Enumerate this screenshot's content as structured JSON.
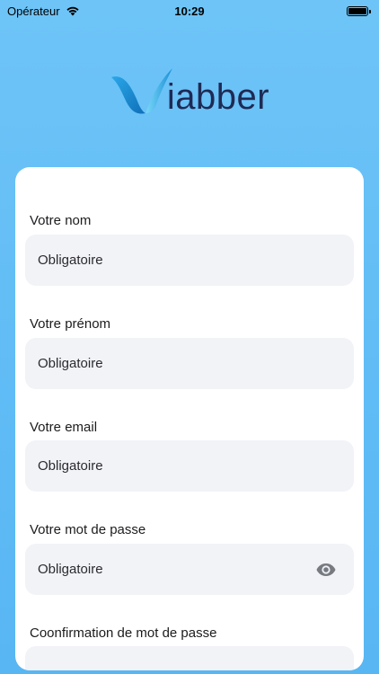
{
  "status_bar": {
    "carrier": "Opérateur",
    "time": "10:29",
    "battery_level": 1.0
  },
  "logo": {
    "mark_letter": "V",
    "text": "iabber",
    "colors": {
      "mark_primary": "#1a8fd6",
      "mark_secondary": "#6ad3f5",
      "text": "#1f2a54"
    }
  },
  "form": {
    "fields": [
      {
        "label": "Votre nom",
        "placeholder": "Obligatoire"
      },
      {
        "label": "Votre prénom",
        "placeholder": "Obligatoire"
      },
      {
        "label": "Votre email",
        "placeholder": "Obligatoire"
      },
      {
        "label": "Votre mot de passe",
        "placeholder": "Obligatoire",
        "icon": "eye-icon"
      },
      {
        "label": "Coonfirmation de mot de passe",
        "placeholder": ""
      }
    ]
  },
  "colors": {
    "background_top": "#6ec4f7",
    "background_bottom": "#58b6f3",
    "card": "#ffffff",
    "input_background": "#f2f3f7"
  }
}
